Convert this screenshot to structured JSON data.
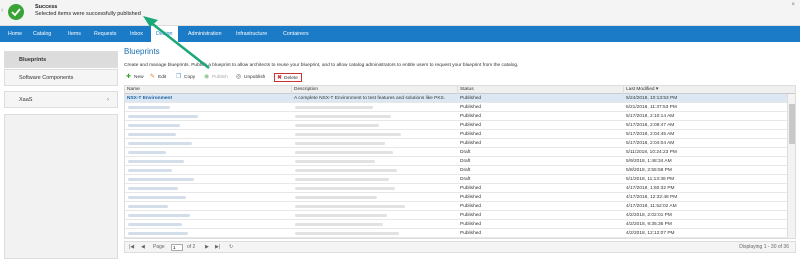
{
  "banner": {
    "title": "Success",
    "message": "Selected items were successfully published",
    "close": "×",
    "back": "‹"
  },
  "nav": {
    "items": [
      "Home",
      "Catalog",
      "Items",
      "Requests",
      "Inbox",
      "Design",
      "Administration",
      "Infrastructure",
      "Containers"
    ],
    "active": "Design"
  },
  "sidebar": {
    "items": [
      {
        "label": "Blueprints"
      },
      {
        "label": "Software Components"
      },
      {
        "label": "XaaS",
        "chevron": "›"
      }
    ]
  },
  "main": {
    "title": "Blueprints",
    "description": "Create and manage blueprints. Publish a blueprint to allow architects to reuse your blueprint, and to allow catalog administrators to entitle users to request your blueprint from the catalog."
  },
  "toolbar": {
    "new": "New",
    "edit": "Edit",
    "copy": "Copy",
    "publish": "Publish",
    "unpublish": "Unpublish",
    "delete": "Delete"
  },
  "table": {
    "columns": [
      "Name",
      "Description",
      "Status",
      "Last Modified ▾"
    ],
    "rows": [
      {
        "name": "NSX-T Environment",
        "description": "A complete NSX-T Environment to test features and solutions like PKS.",
        "status": "Published",
        "modified": "5/24/2018, 10:13:53 PM"
      },
      {
        "name": "",
        "description": "",
        "status": "Published",
        "modified": "5/21/2018, 11:37:53 PM"
      },
      {
        "name": "",
        "description": "",
        "status": "Published",
        "modified": "5/17/2018, 2:10:14 AM"
      },
      {
        "name": "",
        "description": "",
        "status": "Published",
        "modified": "5/17/2018, 2:09:47 AM"
      },
      {
        "name": "",
        "description": "",
        "status": "Published",
        "modified": "5/17/2018, 2:04:45 AM"
      },
      {
        "name": "",
        "description": "",
        "status": "Published",
        "modified": "5/17/2018, 2:04:04 AM"
      },
      {
        "name": "",
        "description": "",
        "status": "Draft",
        "modified": "5/11/2018, 10:24:23 PM"
      },
      {
        "name": "",
        "description": "",
        "status": "Draft",
        "modified": "5/9/2018, 1:48:34 AM"
      },
      {
        "name": "",
        "description": "",
        "status": "Draft",
        "modified": "5/8/2018, 2:55:58 PM"
      },
      {
        "name": "",
        "description": "",
        "status": "Draft",
        "modified": "5/1/2018, 11:13:36 PM"
      },
      {
        "name": "",
        "description": "",
        "status": "Published",
        "modified": "4/17/2018, 1:60:32 PM"
      },
      {
        "name": "",
        "description": "",
        "status": "Published",
        "modified": "4/17/2018, 12:32:48 PM"
      },
      {
        "name": "",
        "description": "",
        "status": "Published",
        "modified": "4/17/2018, 11:52:02 AM"
      },
      {
        "name": "",
        "description": "",
        "status": "Published",
        "modified": "4/2/2018, 2:02:01 PM"
      },
      {
        "name": "",
        "description": "",
        "status": "Published",
        "modified": "4/2/2018, 9:35:36 PM"
      },
      {
        "name": "",
        "description": "",
        "status": "Published",
        "modified": "4/2/2018, 12:12:07 PM"
      }
    ]
  },
  "pager": {
    "page_label": "Page",
    "page_value": "1",
    "of_label": "of 2",
    "display": "Displaying 1 - 30 of 36"
  },
  "colors": {
    "nav": "#1b7bc6",
    "success": "#3aa335",
    "arrow": "#1aa879"
  }
}
